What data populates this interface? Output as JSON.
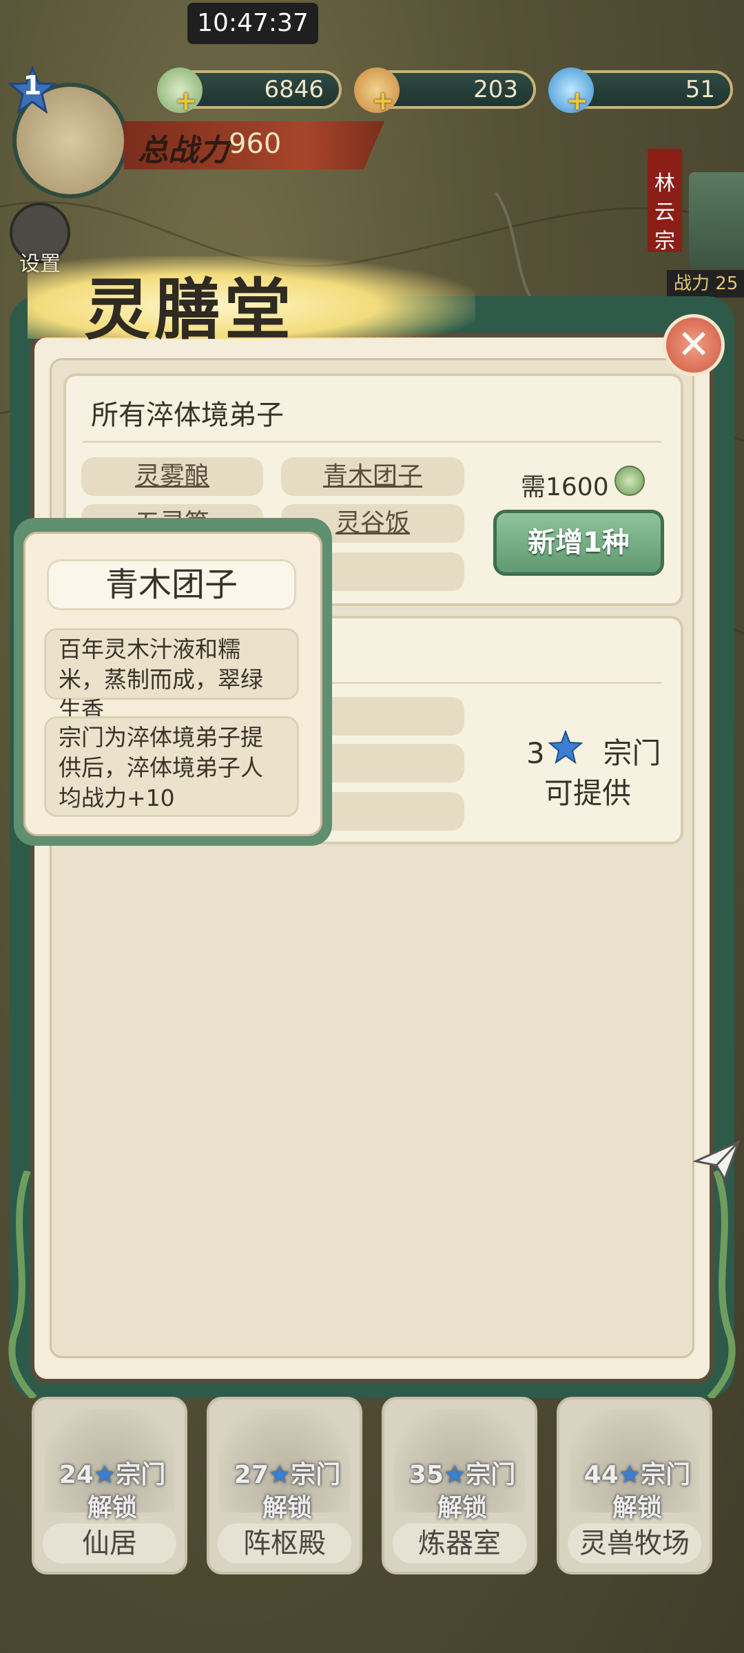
{
  "status_bar": {
    "time": "10:47:37"
  },
  "player": {
    "level": "1",
    "power_label": "总战力",
    "power_value": "960"
  },
  "resources": [
    {
      "icon": "spirit-herb-icon",
      "value": "6846"
    },
    {
      "icon": "grain-bag-icon",
      "value": "203"
    },
    {
      "icon": "crystal-icon",
      "value": "51"
    }
  ],
  "settings_label": "设置",
  "sect": {
    "name_vertical": "林\n云\n宗",
    "power_label": "战力",
    "power_value": "25"
  },
  "dialog": {
    "title": "灵膳堂",
    "card1": {
      "title": "所有淬体境弟子",
      "foods": [
        "灵雾酿",
        "青木团子",
        "五灵笋",
        "灵谷饭",
        ""
      ],
      "need": "需1600",
      "add_button": "新增1种"
    },
    "card2": {
      "requirement_num": "3",
      "requirement_text": "宗门",
      "requirement_line2": "可提供"
    }
  },
  "tooltip": {
    "title": "青木团子",
    "description": "百年灵木汁液和糯米，蒸制而成，翠绿生香",
    "effect": "宗门为淬体境弟子提供后，淬体境弟子人均战力+10"
  },
  "buildings": [
    {
      "num": "24",
      "suffix": "宗门",
      "unlock": "解锁",
      "name": "仙居"
    },
    {
      "num": "27",
      "suffix": "宗门",
      "unlock": "解锁",
      "name": "阵枢殿"
    },
    {
      "num": "35",
      "suffix": "宗门",
      "unlock": "解锁",
      "name": "炼器室"
    },
    {
      "num": "44",
      "suffix": "宗门",
      "unlock": "解锁",
      "name": "灵兽牧场"
    }
  ],
  "colors": {
    "frame_green": "#2e5a4a",
    "panel": "#f4eddb",
    "accent_blue_star": "#3a7fd0",
    "close_red": "#d0563f"
  }
}
